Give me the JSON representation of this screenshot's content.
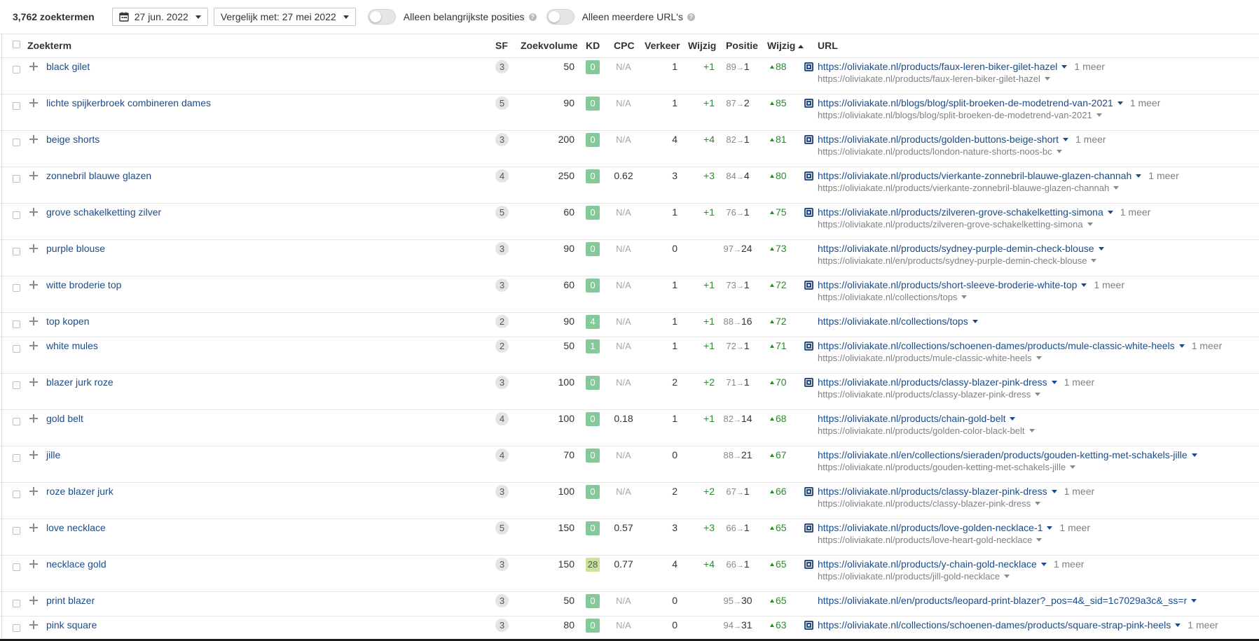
{
  "toolbar": {
    "keyword_count": "3,762 zoekterm­en",
    "date": "27 jun. 2022",
    "compare": "Vergelijk met: 27 mei 2022",
    "toggle1_label": "Alleen belangrijkste posities",
    "toggle2_label": "Alleen meerdere URL's",
    "help_glyph": "?"
  },
  "columns": {
    "term": "Zoekterm",
    "sf": "SF",
    "volume": "Zoekvolume",
    "kd": "KD",
    "cpc": "CPC",
    "traffic": "Verkeer",
    "change": "Wijzig",
    "position": "Positie",
    "pos_change": "Wijzig",
    "url": "URL"
  },
  "colors": {
    "kd_easy": "#86c999",
    "kd_medium": "#c9e39b",
    "link": "#1a4c8b",
    "positive": "#2b8a2b"
  },
  "rows": [
    {
      "term": "black gilet",
      "sf": "3",
      "volume": "50",
      "kd": "0",
      "cpc": "N/A",
      "traffic": "1",
      "change": "+1",
      "pos_from": "89",
      "pos_to": "1",
      "pos_change": "88",
      "url": "https://oliviakate.nl/products/faux-leren-biker-gilet-hazel",
      "more": "1 meer",
      "url2": "https://oliviakate.nl/products/faux-leren-biker-gilet-hazel"
    },
    {
      "term": "lichte spijkerbroek combineren dames",
      "sf": "5",
      "volume": "90",
      "kd": "0",
      "cpc": "N/A",
      "traffic": "1",
      "change": "+1",
      "pos_from": "87",
      "pos_to": "2",
      "pos_change": "85",
      "url": "https://oliviakate.nl/blogs/blog/split-broeken-de-modetrend-van-2021",
      "more": "1 meer",
      "url2": "https://oliviakate.nl/blogs/blog/split-broeken-de-modetrend-van-2021"
    },
    {
      "term": "beige shorts",
      "sf": "3",
      "volume": "200",
      "kd": "0",
      "cpc": "N/A",
      "traffic": "4",
      "change": "+4",
      "pos_from": "82",
      "pos_to": "1",
      "pos_change": "81",
      "url": "https://oliviakate.nl/products/golden-buttons-beige-short",
      "more": "1 meer",
      "url2": "https://oliviakate.nl/products/london-nature-shorts-noos-bc"
    },
    {
      "term": "zonnebril blauwe glazen",
      "sf": "4",
      "volume": "250",
      "kd": "0",
      "cpc": "0.62",
      "traffic": "3",
      "change": "+3",
      "pos_from": "84",
      "pos_to": "4",
      "pos_change": "80",
      "url": "https://oliviakate.nl/products/vierkante-zonnebril-blauwe-glazen-channah",
      "more": "1 meer",
      "url2": "https://oliviakate.nl/products/vierkante-zonnebril-blauwe-glazen-channah"
    },
    {
      "term": "grove schakelketting zilver",
      "sf": "5",
      "volume": "60",
      "kd": "0",
      "cpc": "N/A",
      "traffic": "1",
      "change": "+1",
      "pos_from": "76",
      "pos_to": "1",
      "pos_change": "75",
      "url": "https://oliviakate.nl/products/zilveren-grove-schakelketting-simona",
      "more": "1 meer",
      "url2": "https://oliviakate.nl/products/zilveren-grove-schakelketting-simona"
    },
    {
      "term": "purple blouse",
      "sf": "3",
      "volume": "90",
      "kd": "0",
      "cpc": "N/A",
      "traffic": "0",
      "change": "",
      "pos_from": "97",
      "pos_to": "24",
      "pos_change": "73",
      "url": "https://oliviakate.nl/products/sydney-purple-demin-check-blouse",
      "more": "",
      "url2": "https://oliviakate.nl/en/products/sydney-purple-demin-check-blouse"
    },
    {
      "term": "witte broderie top",
      "sf": "3",
      "volume": "60",
      "kd": "0",
      "cpc": "N/A",
      "traffic": "1",
      "change": "+1",
      "pos_from": "73",
      "pos_to": "1",
      "pos_change": "72",
      "url": "https://oliviakate.nl/products/short-sleeve-broderie-white-top",
      "more": "1 meer",
      "url2": "https://oliviakate.nl/collections/tops"
    },
    {
      "term": "top kopen",
      "sf": "2",
      "volume": "90",
      "kd": "4",
      "cpc": "N/A",
      "traffic": "1",
      "change": "+1",
      "pos_from": "88",
      "pos_to": "16",
      "pos_change": "72",
      "url": "https://oliviakate.nl/collections/tops",
      "more": "",
      "url2": ""
    },
    {
      "term": "white mules",
      "sf": "2",
      "volume": "50",
      "kd": "1",
      "cpc": "N/A",
      "traffic": "1",
      "change": "+1",
      "pos_from": "72",
      "pos_to": "1",
      "pos_change": "71",
      "url": "https://oliviakate.nl/collections/schoenen-dames/products/mule-classic-white-heels",
      "more": "1 meer",
      "url2": "https://oliviakate.nl/products/mule-classic-white-heels"
    },
    {
      "term": "blazer jurk roze",
      "sf": "3",
      "volume": "100",
      "kd": "0",
      "cpc": "N/A",
      "traffic": "2",
      "change": "+2",
      "pos_from": "71",
      "pos_to": "1",
      "pos_change": "70",
      "url": "https://oliviakate.nl/products/classy-blazer-pink-dress",
      "more": "1 meer",
      "url2": "https://oliviakate.nl/products/classy-blazer-pink-dress"
    },
    {
      "term": "gold belt",
      "sf": "4",
      "volume": "100",
      "kd": "0",
      "cpc": "0.18",
      "traffic": "1",
      "change": "+1",
      "pos_from": "82",
      "pos_to": "14",
      "pos_change": "68",
      "url": "https://oliviakate.nl/products/chain-gold-belt",
      "more": "",
      "url2": "https://oliviakate.nl/products/golden-color-black-belt"
    },
    {
      "term": "jille",
      "sf": "4",
      "volume": "70",
      "kd": "0",
      "cpc": "N/A",
      "traffic": "0",
      "change": "",
      "pos_from": "88",
      "pos_to": "21",
      "pos_change": "67",
      "url": "https://oliviakate.nl/en/collections/sieraden/products/gouden-ketting-met-schakels-jille",
      "more": "",
      "url2": "https://oliviakate.nl/products/gouden-ketting-met-schakels-jille"
    },
    {
      "term": "roze blazer jurk",
      "sf": "3",
      "volume": "100",
      "kd": "0",
      "cpc": "N/A",
      "traffic": "2",
      "change": "+2",
      "pos_from": "67",
      "pos_to": "1",
      "pos_change": "66",
      "url": "https://oliviakate.nl/products/classy-blazer-pink-dress",
      "more": "1 meer",
      "url2": "https://oliviakate.nl/products/classy-blazer-pink-dress"
    },
    {
      "term": "love necklace",
      "sf": "5",
      "volume": "150",
      "kd": "0",
      "cpc": "0.57",
      "traffic": "3",
      "change": "+3",
      "pos_from": "66",
      "pos_to": "1",
      "pos_change": "65",
      "url": "https://oliviakate.nl/products/love-golden-necklace-1",
      "more": "1 meer",
      "url2": "https://oliviakate.nl/products/love-heart-gold-necklace"
    },
    {
      "term": "necklace gold",
      "sf": "3",
      "volume": "150",
      "kd": "28",
      "cpc": "0.77",
      "traffic": "4",
      "change": "+4",
      "pos_from": "66",
      "pos_to": "1",
      "pos_change": "65",
      "url": "https://oliviakate.nl/products/y-chain-gold-necklace",
      "more": "1 meer",
      "url2": "https://oliviakate.nl/products/jill-gold-necklace"
    },
    {
      "term": "print blazer",
      "sf": "3",
      "volume": "50",
      "kd": "0",
      "cpc": "N/A",
      "traffic": "0",
      "change": "",
      "pos_from": "95",
      "pos_to": "30",
      "pos_change": "65",
      "url": "https://oliviakate.nl/en/products/leopard-print-blazer?_pos=4&_sid=1c7029a3c&_ss=r",
      "more": "",
      "url2": ""
    },
    {
      "term": "pink square",
      "sf": "3",
      "volume": "80",
      "kd": "0",
      "cpc": "N/A",
      "traffic": "0",
      "change": "",
      "pos_from": "94",
      "pos_to": "31",
      "pos_change": "63",
      "url": "https://oliviakate.nl/collections/schoenen-dames/products/square-strap-pink-heels",
      "more": "1 meer",
      "url2": ""
    }
  ]
}
